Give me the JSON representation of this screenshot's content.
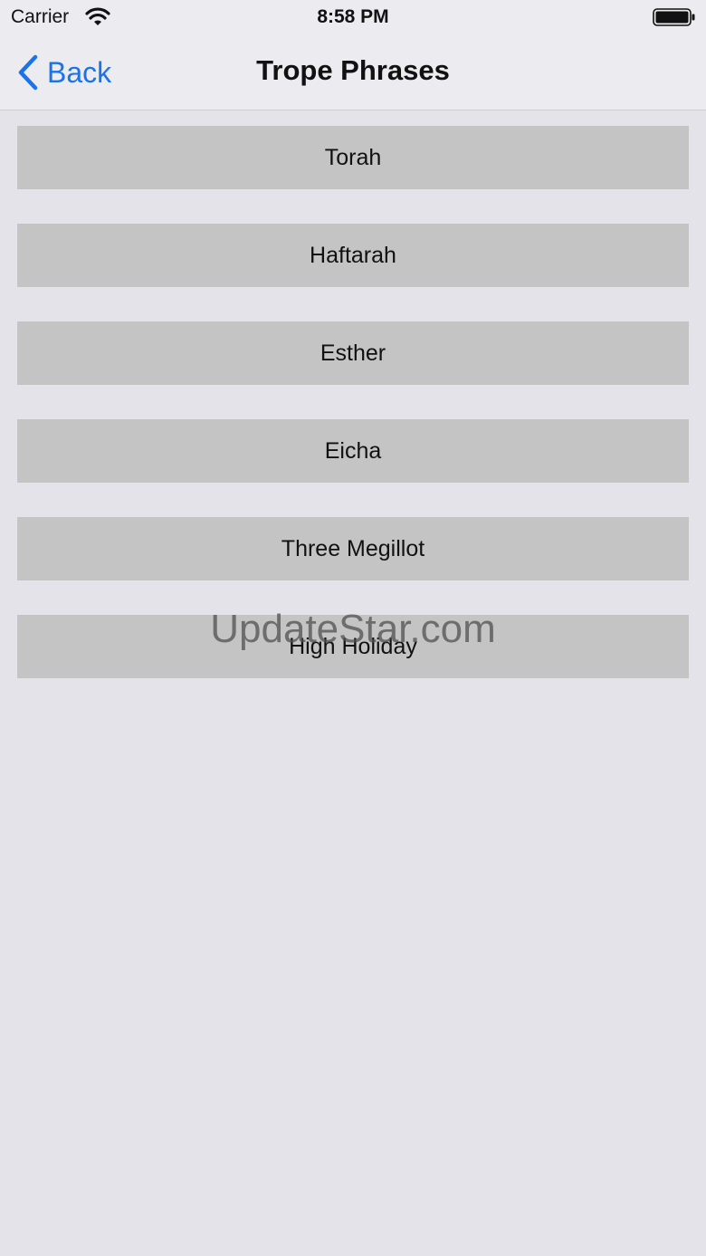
{
  "status_bar": {
    "carrier": "Carrier",
    "time": "8:58 PM",
    "wifi_icon": "wifi-icon",
    "battery_icon": "battery-full-icon"
  },
  "nav": {
    "back_label": "Back",
    "back_icon": "chevron-left-icon",
    "title": "Trope Phrases",
    "accent_color": "#1a73e8"
  },
  "items": [
    {
      "label": "Torah"
    },
    {
      "label": "Haftarah"
    },
    {
      "label": "Esther"
    },
    {
      "label": "Eicha"
    },
    {
      "label": "Three Megillot"
    },
    {
      "label": "High Holiday"
    }
  ],
  "watermark": "UpdateStar.com"
}
